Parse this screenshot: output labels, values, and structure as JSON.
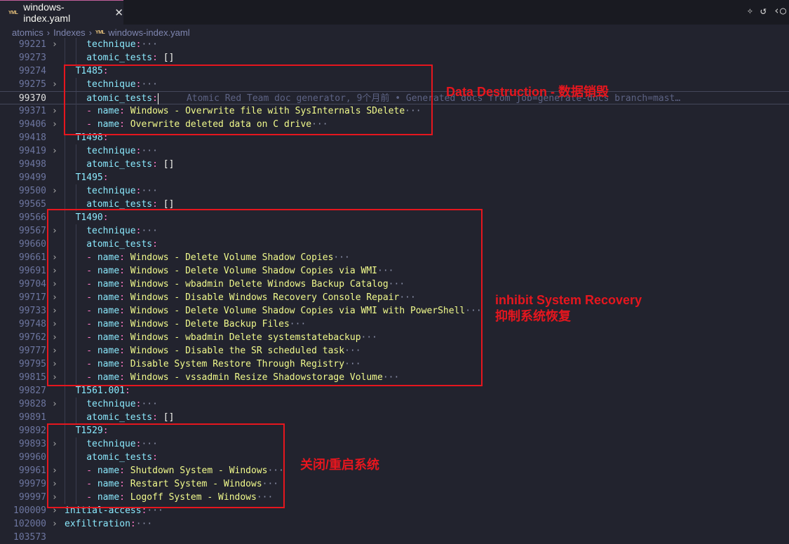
{
  "tab": {
    "title": "windows-index.yaml",
    "file_icon": "yaml-icon",
    "close_icon": "close-icon"
  },
  "actions": [
    "sparkle-icon",
    "history-icon",
    "compare-icon"
  ],
  "breadcrumb": [
    "atomics",
    "Indexes",
    "windows-index.yaml"
  ],
  "blame": "Atomic Red Team doc generator, 9个月前 • Generated docs from job=generate-docs branch=mast…",
  "lines": [
    {
      "n": "99221",
      "i": 2,
      "f": true,
      "key": "technique",
      "fold_text": "···"
    },
    {
      "n": "99273",
      "i": 2,
      "key": "atomic_tests",
      "val": "[]"
    },
    {
      "n": "99274",
      "i": 1,
      "key": "T1485"
    },
    {
      "n": "99275",
      "i": 2,
      "f": true,
      "key": "technique",
      "fold_text": "···"
    },
    {
      "n": "99370",
      "i": 2,
      "key": "atomic_tests",
      "cur": true
    },
    {
      "n": "99371",
      "i": 2,
      "f": true,
      "dash": true,
      "key": "name",
      "val": "Windows - Overwrite file with SysInternals SDelete",
      "fold_text": "···"
    },
    {
      "n": "99406",
      "i": 2,
      "f": true,
      "dash": true,
      "key": "name",
      "val": "Overwrite deleted data on C drive",
      "fold_text": "···"
    },
    {
      "n": "99418",
      "i": 1,
      "key": "T1498"
    },
    {
      "n": "99419",
      "i": 2,
      "f": true,
      "key": "technique",
      "fold_text": "···"
    },
    {
      "n": "99498",
      "i": 2,
      "key": "atomic_tests",
      "val": "[]"
    },
    {
      "n": "99499",
      "i": 1,
      "key": "T1495"
    },
    {
      "n": "99500",
      "i": 2,
      "f": true,
      "key": "technique",
      "fold_text": "···"
    },
    {
      "n": "99565",
      "i": 2,
      "key": "atomic_tests",
      "val": "[]"
    },
    {
      "n": "99566",
      "i": 1,
      "key": "T1490"
    },
    {
      "n": "99567",
      "i": 2,
      "f": true,
      "key": "technique",
      "fold_text": "···"
    },
    {
      "n": "99660",
      "i": 2,
      "key": "atomic_tests"
    },
    {
      "n": "99661",
      "i": 2,
      "f": true,
      "dash": true,
      "key": "name",
      "val": "Windows - Delete Volume Shadow Copies",
      "fold_text": "···"
    },
    {
      "n": "99691",
      "i": 2,
      "f": true,
      "dash": true,
      "key": "name",
      "val": "Windows - Delete Volume Shadow Copies via WMI",
      "fold_text": "···"
    },
    {
      "n": "99704",
      "i": 2,
      "f": true,
      "dash": true,
      "key": "name",
      "val": "Windows - wbadmin Delete Windows Backup Catalog",
      "fold_text": "···"
    },
    {
      "n": "99717",
      "i": 2,
      "f": true,
      "dash": true,
      "key": "name",
      "val": "Windows - Disable Windows Recovery Console Repair",
      "fold_text": "···"
    },
    {
      "n": "99733",
      "i": 2,
      "f": true,
      "dash": true,
      "key": "name",
      "val": "Windows - Delete Volume Shadow Copies via WMI with PowerShell",
      "fold_text": "···"
    },
    {
      "n": "99748",
      "i": 2,
      "f": true,
      "dash": true,
      "key": "name",
      "val": "Windows - Delete Backup Files",
      "fold_text": "···"
    },
    {
      "n": "99762",
      "i": 2,
      "f": true,
      "dash": true,
      "key": "name",
      "val": "Windows - wbadmin Delete systemstatebackup",
      "fold_text": "···"
    },
    {
      "n": "99777",
      "i": 2,
      "f": true,
      "dash": true,
      "key": "name",
      "val": "Windows - Disable the SR scheduled task",
      "fold_text": "···"
    },
    {
      "n": "99795",
      "i": 2,
      "f": true,
      "dash": true,
      "key": "name",
      "val": "Disable System Restore Through Registry",
      "fold_text": "···"
    },
    {
      "n": "99815",
      "i": 2,
      "f": true,
      "dash": true,
      "key": "name",
      "val": "Windows - vssadmin Resize Shadowstorage Volume",
      "fold_text": "···"
    },
    {
      "n": "99827",
      "i": 1,
      "key": "T1561.001"
    },
    {
      "n": "99828",
      "i": 2,
      "f": true,
      "key": "technique",
      "fold_text": "···"
    },
    {
      "n": "99891",
      "i": 2,
      "key": "atomic_tests",
      "val": "[]"
    },
    {
      "n": "99892",
      "i": 1,
      "key": "T1529"
    },
    {
      "n": "99893",
      "i": 2,
      "f": true,
      "key": "technique",
      "fold_text": "···"
    },
    {
      "n": "99960",
      "i": 2,
      "key": "atomic_tests"
    },
    {
      "n": "99961",
      "i": 2,
      "f": true,
      "dash": true,
      "key": "name",
      "val": "Shutdown System - Windows",
      "fold_text": "···"
    },
    {
      "n": "99979",
      "i": 2,
      "f": true,
      "dash": true,
      "key": "name",
      "val": "Restart System - Windows",
      "fold_text": "···"
    },
    {
      "n": "99997",
      "i": 2,
      "f": true,
      "dash": true,
      "key": "name",
      "val": "Logoff System - Windows",
      "fold_text": "···"
    },
    {
      "n": "100009",
      "i": 0,
      "f": true,
      "key": "initial-access",
      "fold_text": "···"
    },
    {
      "n": "102000",
      "i": 0,
      "f": true,
      "key": "exfiltration",
      "fold_text": "···"
    },
    {
      "n": "103573",
      "i": 0
    }
  ],
  "annotations": {
    "data_destruction": "Data Destruction - 数据销毁",
    "inhibit_en": "inhibit System Recovery",
    "inhibit_zh": "抑制系统恢复",
    "shutdown": "关闭/重启系统"
  },
  "colors": {
    "annotation": "#e6161e",
    "key": "#8be9fd",
    "value": "#f1fa8c",
    "punct": "#ff79c6"
  }
}
